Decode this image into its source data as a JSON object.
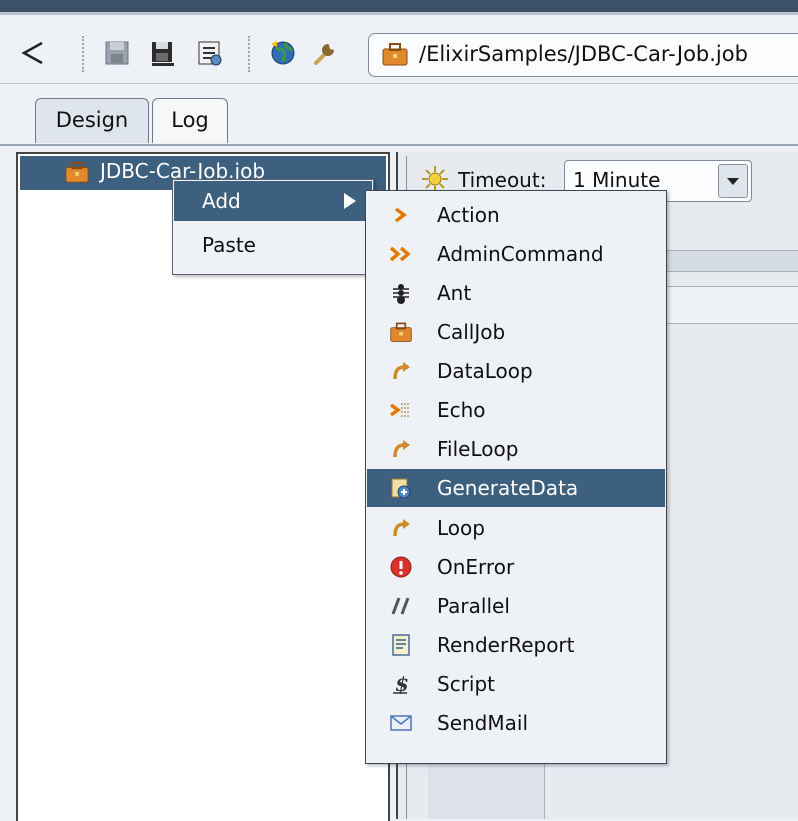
{
  "toolbar": {
    "path": "/ElixirSamples/JDBC-Car-Job.job"
  },
  "tabs": [
    {
      "label": "Design",
      "active": true
    },
    {
      "label": "Log",
      "active": false
    }
  ],
  "tree": {
    "root_label": "JDBC-Car-Job.job"
  },
  "properties": {
    "timeout_label": "Timeout:",
    "timeout_value": "1 Minute"
  },
  "context_menu": {
    "items": [
      {
        "label": "Add",
        "has_submenu": true,
        "highlighted": true
      },
      {
        "label": "Paste",
        "has_submenu": false,
        "highlighted": false
      }
    ]
  },
  "add_submenu": {
    "items": [
      {
        "label": "Action",
        "icon": "action-chevron-icon"
      },
      {
        "label": "AdminCommand",
        "icon": "double-chevron-icon"
      },
      {
        "label": "Ant",
        "icon": "ant-icon"
      },
      {
        "label": "CallJob",
        "icon": "briefcase-icon"
      },
      {
        "label": "DataLoop",
        "icon": "loop-arrow-icon"
      },
      {
        "label": "Echo",
        "icon": "echo-icon"
      },
      {
        "label": "FileLoop",
        "icon": "loop-arrow-icon"
      },
      {
        "label": "GenerateData",
        "icon": "generate-data-icon",
        "highlighted": true
      },
      {
        "label": "Loop",
        "icon": "loop-arrow-icon"
      },
      {
        "label": "OnError",
        "icon": "error-icon"
      },
      {
        "label": "Parallel",
        "icon": "parallel-icon"
      },
      {
        "label": "RenderReport",
        "icon": "report-icon"
      },
      {
        "label": "Script",
        "icon": "script-dollar-icon"
      },
      {
        "label": "SendMail",
        "icon": "envelope-icon"
      }
    ]
  },
  "colors": {
    "selection": "#3d607f",
    "menu_bg": "#eef1f6",
    "chevron_orange": "#e07b00"
  }
}
